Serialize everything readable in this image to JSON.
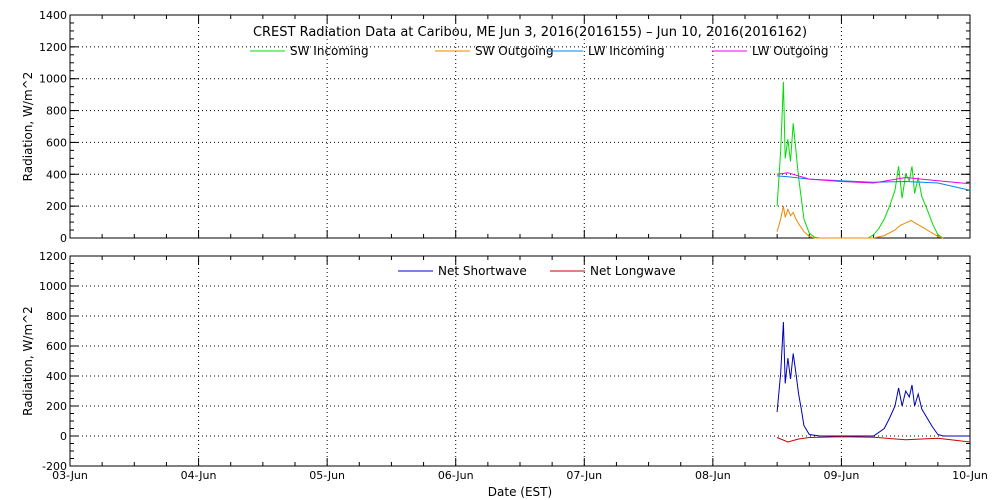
{
  "chart_data": [
    {
      "type": "line",
      "title": "CREST Radiation Data at Caribou, ME   Jun  3, 2016(2016155) – Jun 10, 2016(2016162)",
      "ylabel": "Radiation, W/m^2",
      "ylim": [
        0,
        1400
      ],
      "yticks": [
        0,
        200,
        400,
        600,
        800,
        1000,
        1200,
        1400
      ],
      "xlim": [
        "2016-06-03",
        "2016-06-10"
      ],
      "grid": true,
      "legend": "top",
      "series": [
        {
          "name": "SW Incoming",
          "color": "#00dd00",
          "x": [
            "06-08 12:00",
            "06-08 12:40",
            "06-08 13:10",
            "06-08 13:30",
            "06-08 14:00",
            "06-08 14:30",
            "06-08 15:00",
            "06-08 15:30",
            "06-08 16:00",
            "06-08 16:30",
            "06-08 17:00",
            "06-08 18:00",
            "06-08 19:00",
            "06-08 20:00",
            "06-09 05:00",
            "06-09 06:00",
            "06-09 07:00",
            "06-09 08:00",
            "06-09 09:00",
            "06-09 10:00",
            "06-09 10:40",
            "06-09 11:20",
            "06-09 12:00",
            "06-09 12:40",
            "06-09 13:10",
            "06-09 13:40",
            "06-09 14:20",
            "06-09 15:00",
            "06-09 16:00",
            "06-09 17:00",
            "06-09 18:00",
            "06-09 19:00"
          ],
          "y": [
            200,
            550,
            980,
            500,
            620,
            480,
            720,
            550,
            380,
            250,
            120,
            30,
            5,
            0,
            0,
            20,
            60,
            120,
            200,
            300,
            450,
            250,
            400,
            360,
            450,
            280,
            380,
            260,
            180,
            90,
            20,
            0
          ]
        },
        {
          "name": "SW Outgoing",
          "color": "#ee8800",
          "x": [
            "06-08 12:00",
            "06-08 12:40",
            "06-08 13:10",
            "06-08 13:30",
            "06-08 14:00",
            "06-08 14:30",
            "06-08 15:00",
            "06-08 15:30",
            "06-08 16:00",
            "06-08 17:00",
            "06-08 18:00",
            "06-08 19:00",
            "06-09 06:00",
            "06-09 08:00",
            "06-09 10:00",
            "06-09 11:00",
            "06-09 12:00",
            "06-09 13:00",
            "06-09 14:00",
            "06-09 15:00",
            "06-09 16:00",
            "06-09 17:00",
            "06-09 18:00",
            "06-09 19:00"
          ],
          "y": [
            40,
            120,
            200,
            130,
            180,
            140,
            160,
            120,
            90,
            40,
            10,
            0,
            0,
            15,
            50,
            80,
            95,
            110,
            90,
            70,
            50,
            30,
            10,
            0
          ]
        },
        {
          "name": "LW Incoming",
          "color": "#0088ee",
          "x": [
            "06-08 12:00",
            "06-08 14:00",
            "06-08 18:00",
            "06-09 00:00",
            "06-09 06:00",
            "06-09 12:00",
            "06-09 18:00",
            "06-10 00:00"
          ],
          "y": [
            390,
            385,
            370,
            360,
            350,
            355,
            345,
            300
          ]
        },
        {
          "name": "LW Outgoing",
          "color": "#ee00ee",
          "x": [
            "06-08 12:00",
            "06-08 14:00",
            "06-08 18:00",
            "06-09 00:00",
            "06-09 06:00",
            "06-09 12:00",
            "06-09 18:00",
            "06-10 00:00"
          ],
          "y": [
            400,
            410,
            370,
            355,
            345,
            380,
            360,
            340
          ]
        }
      ]
    },
    {
      "type": "line",
      "xlabel": "Date (EST)",
      "ylabel": "Radiation, W/m^2",
      "ylim": [
        -200,
        1200
      ],
      "yticks": [
        -200,
        0,
        200,
        400,
        600,
        800,
        1000,
        1200
      ],
      "xlim": [
        "2016-06-03",
        "2016-06-10"
      ],
      "grid": true,
      "legend": "top",
      "series": [
        {
          "name": "Net Shortwave",
          "color": "#0000bb",
          "x": [
            "06-08 12:00",
            "06-08 12:40",
            "06-08 13:10",
            "06-08 13:30",
            "06-08 14:00",
            "06-08 14:30",
            "06-08 15:00",
            "06-08 15:30",
            "06-08 16:00",
            "06-08 16:30",
            "06-08 17:00",
            "06-08 18:00",
            "06-08 20:00",
            "06-09 06:00",
            "06-09 08:00",
            "06-09 09:00",
            "06-09 10:00",
            "06-09 10:40",
            "06-09 11:20",
            "06-09 12:00",
            "06-09 12:40",
            "06-09 13:10",
            "06-09 13:40",
            "06-09 14:20",
            "06-09 15:00",
            "06-09 16:00",
            "06-09 17:00",
            "06-09 18:00",
            "06-09 19:00",
            "06-10 00:00"
          ],
          "y": [
            160,
            420,
            760,
            350,
            520,
            380,
            550,
            420,
            280,
            180,
            70,
            10,
            0,
            0,
            50,
            120,
            200,
            320,
            200,
            300,
            260,
            340,
            200,
            280,
            180,
            120,
            60,
            10,
            0,
            0
          ]
        },
        {
          "name": "Net Longwave",
          "color": "#cc0000",
          "x": [
            "06-08 12:00",
            "06-08 14:00",
            "06-08 16:00",
            "06-08 18:00",
            "06-09 00:00",
            "06-09 06:00",
            "06-09 12:00",
            "06-09 18:00",
            "06-10 00:00"
          ],
          "y": [
            -10,
            -40,
            -20,
            -10,
            -5,
            -8,
            -25,
            -15,
            -40
          ]
        }
      ]
    }
  ],
  "x_tick_labels": [
    "03-Jun",
    "04-Jun",
    "05-Jun",
    "06-Jun",
    "07-Jun",
    "08-Jun",
    "09-Jun",
    "10-Jun"
  ]
}
